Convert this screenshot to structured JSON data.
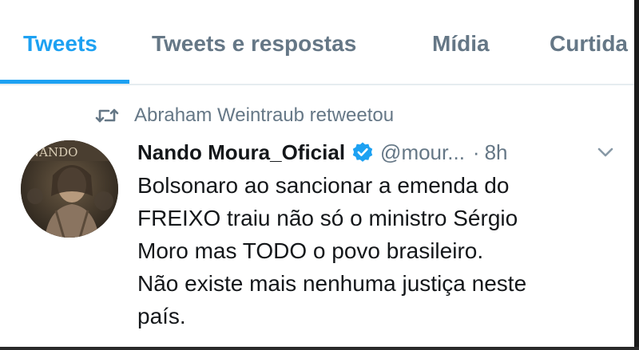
{
  "tabs": [
    {
      "label": "Tweets",
      "active": true
    },
    {
      "label": "Tweets e respostas",
      "active": false
    },
    {
      "label": "Mídia",
      "active": false
    },
    {
      "label": "Curtida",
      "active": false
    }
  ],
  "retweet": {
    "icon": "retweet-icon",
    "text": "Abraham Weintraub retweetou"
  },
  "tweet": {
    "avatar_text": "NANDO",
    "display_name": "Nando Moura_Oficial",
    "verified_icon": "verified-badge-icon",
    "handle": "@mour...",
    "separator": "·",
    "time": "8h",
    "menu_icon": "chevron-down-icon",
    "lines": [
      "Bolsonaro ao sancionar a emenda do",
      "FREIXO traiu não só o ministro Sérgio",
      "Moro mas TODO o povo brasileiro.",
      "Não existe mais nenhuma justiça neste",
      "país."
    ]
  },
  "colors": {
    "accent": "#1da1f2",
    "muted": "#657786",
    "text": "#14171a",
    "divider": "#e6ecf0"
  }
}
